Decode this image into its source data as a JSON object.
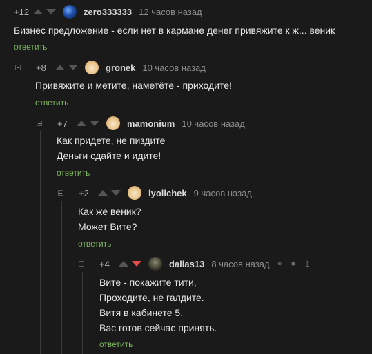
{
  "comments": [
    {
      "rating": "+12",
      "author": "zero333333",
      "time": "12 часов назад",
      "lines": [
        "Бизнес предложение - если нет в кармане денег привяжите к ж... веник"
      ],
      "reply": "ответить"
    },
    {
      "rating": "+8",
      "author": "gronek",
      "time": "10 часов назад",
      "lines": [
        "Привяжите и метите, наметёте - приходите!"
      ],
      "reply": "ответить"
    },
    {
      "rating": "+7",
      "author": "mamonium",
      "time": "10 часов назад",
      "lines": [
        "Как придете, не пиздите",
        "Деньги сдайте и идите!"
      ],
      "reply": "ответить"
    },
    {
      "rating": "+2",
      "author": "lyolichek",
      "time": "9 часов назад",
      "lines": [
        "Как же веник?",
        "Может Вите?"
      ],
      "reply": "ответить"
    },
    {
      "rating": "+4",
      "author": "dallas13",
      "time": "8 часов назад",
      "lines": [
        "Вите - покажите тити,",
        "Проходите, не галдите.",
        "Витя в кабинете 5,",
        "Вас готов сейчас принять."
      ],
      "reply": "ответить"
    }
  ],
  "colors": {
    "background": "#1a1a1a",
    "reply_link": "#7fb85e",
    "downvote_active": "#e34e4e"
  },
  "icons": [
    "collapse-icon",
    "upvote-arrow-icon",
    "downvote-arrow-icon",
    "link-icon",
    "save-icon",
    "jump-to-top-icon"
  ]
}
